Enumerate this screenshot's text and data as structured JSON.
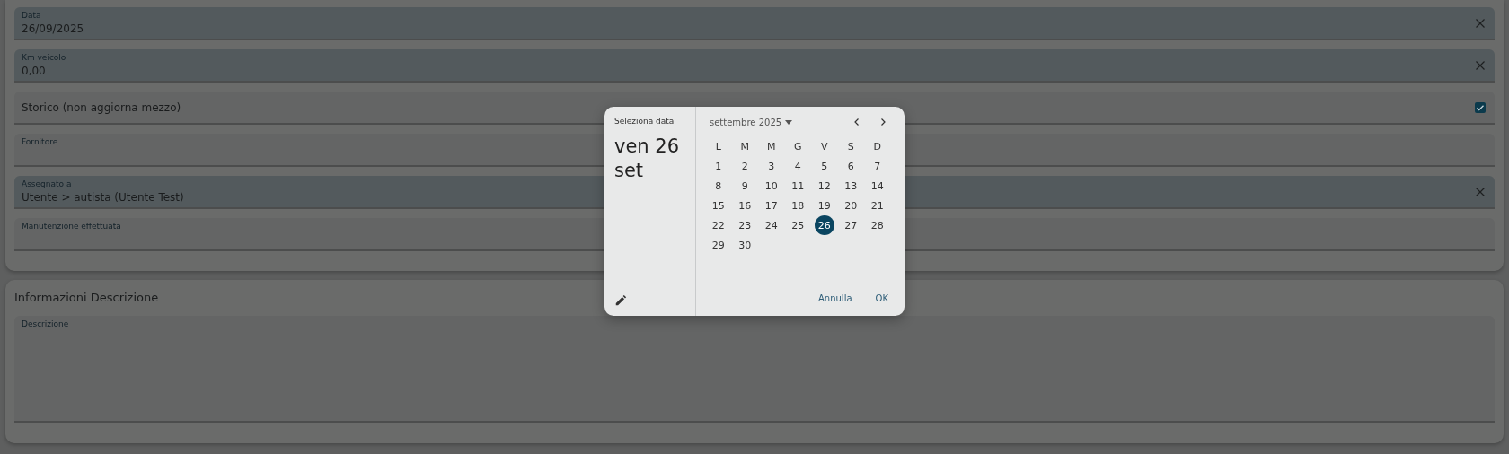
{
  "form": {
    "fields": [
      {
        "kind": "text",
        "label": "Data",
        "value": "26/09/2025",
        "clearable": true
      },
      {
        "kind": "text",
        "label": "Km veicolo",
        "value": "0,00",
        "clearable": true
      },
      {
        "kind": "checkbox",
        "label": "Storico (non aggiorna mezzo)",
        "checked": true
      },
      {
        "kind": "text",
        "label": "Fornitore",
        "clearable": false
      },
      {
        "kind": "text",
        "label": "Assegnato a",
        "value": "Utente > autista (Utente Test)",
        "clearable": true
      },
      {
        "kind": "text",
        "label": "Manutenzione effettuata",
        "clearable": false
      }
    ]
  },
  "description_section": {
    "title": "Informazioni Descrizione",
    "field": {
      "label": "Descrizione"
    }
  },
  "date_picker": {
    "heading": "Seleziona data",
    "selected_date": "ven 26 set",
    "month": "settembre 2025",
    "weekdays": [
      "L",
      "M",
      "M",
      "G",
      "V",
      "S",
      "D"
    ],
    "days": [
      {
        "label": "1",
        "selected": false
      },
      {
        "label": "2",
        "selected": false
      },
      {
        "label": "3",
        "selected": false
      },
      {
        "label": "4",
        "selected": false
      },
      {
        "label": "5",
        "selected": false
      },
      {
        "label": "6",
        "selected": false
      },
      {
        "label": "7",
        "selected": false
      },
      {
        "label": "8",
        "selected": false
      },
      {
        "label": "9",
        "selected": false
      },
      {
        "label": "10",
        "selected": false
      },
      {
        "label": "11",
        "selected": false
      },
      {
        "label": "12",
        "selected": false
      },
      {
        "label": "13",
        "selected": false
      },
      {
        "label": "14",
        "selected": false
      },
      {
        "label": "15",
        "selected": false
      },
      {
        "label": "16",
        "selected": false
      },
      {
        "label": "17",
        "selected": false
      },
      {
        "label": "18",
        "selected": false
      },
      {
        "label": "19",
        "selected": false
      },
      {
        "label": "20",
        "selected": false
      },
      {
        "label": "21",
        "selected": false
      },
      {
        "label": "22",
        "selected": false
      },
      {
        "label": "23",
        "selected": false
      },
      {
        "label": "24",
        "selected": false
      },
      {
        "label": "25",
        "selected": false
      },
      {
        "label": "26",
        "selected": true
      },
      {
        "label": "27",
        "selected": false
      },
      {
        "label": "28",
        "selected": false
      },
      {
        "label": "29",
        "selected": false
      },
      {
        "label": "30",
        "selected": false
      }
    ],
    "buttons": [
      "Annulla",
      "OK"
    ]
  }
}
